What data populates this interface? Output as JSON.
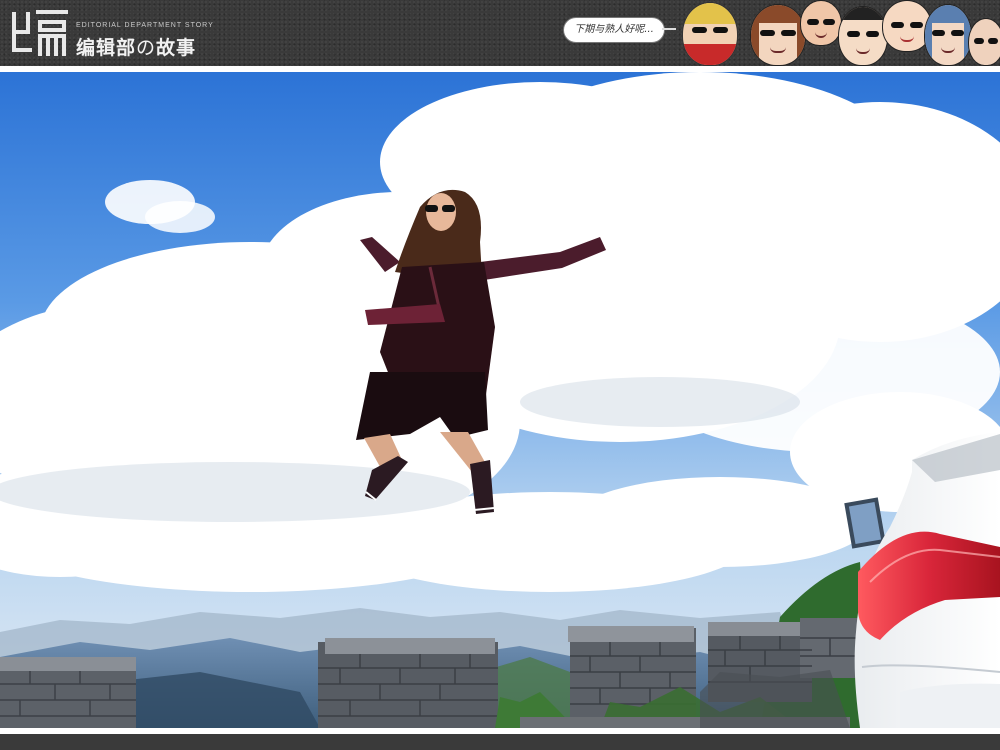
{
  "header": {
    "logo_glyph": "编",
    "logo_subtitle": "EDITORIAL DEPARTMENT STORY",
    "logo_title_part1": "编辑部",
    "logo_title_no": "の",
    "logo_title_part2": "故事",
    "speech_bubble": "下期与熟人好呢..."
  },
  "colors": {
    "header_bg": "#3a3a3a",
    "sky": "#2f78d8",
    "car_tail_light": "#d9263a"
  },
  "icons": {
    "avatar_strip": "editor-caricature-faces"
  }
}
